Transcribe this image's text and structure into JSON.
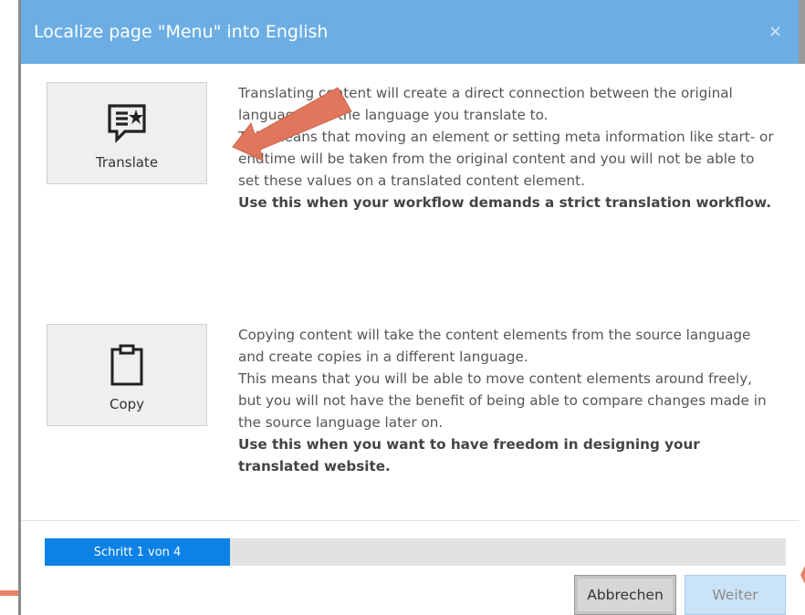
{
  "dialog": {
    "title": "Localize page \"Menu\" into English",
    "close_label": "×"
  },
  "options": [
    {
      "label": "Translate",
      "icon": "translate-speech-icon",
      "description_lines": [
        "Translating content will create a direct connection between the original language and the language you translate to.",
        "This means that moving an element or setting meta information like start- or endtime will be taken from the original content and you will not be able to set these values on a translated content element."
      ],
      "emphasis": "Use this when your workflow demands a strict translation workflow."
    },
    {
      "label": "Copy",
      "icon": "clipboard-icon",
      "description_lines": [
        "Copying content will take the content elements from the source language and create copies in a different language.",
        "This means that you will be able to move content elements around freely, but you will not have the benefit of being able to compare changes made in the source language later on."
      ],
      "emphasis": "Use this when you want to have freedom in designing your translated website."
    }
  ],
  "progress": {
    "label": "Schritt 1 von 4",
    "fraction": 0.25
  },
  "footer": {
    "cancel_label": "Abbrechen",
    "next_label": "Weiter"
  },
  "colors": {
    "header": "#6caee4",
    "progress_fill": "#0c81e6",
    "annotation_arrow": "#e8826a"
  }
}
